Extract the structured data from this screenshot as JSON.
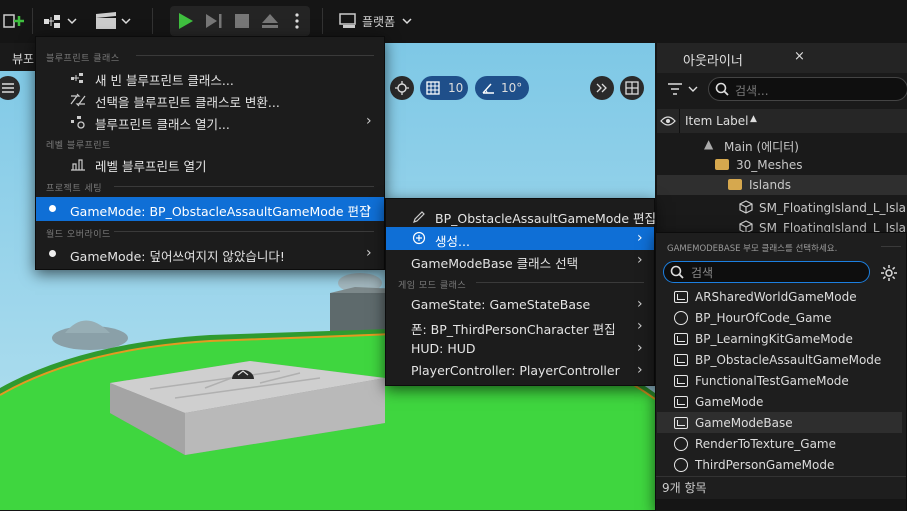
{
  "toolbar": {
    "platform_label": "플랫폼",
    "icons": [
      "add-content-icon",
      "blueprint-icon",
      "cinematics-icon",
      "play-icon",
      "step-icon",
      "stop-icon",
      "eject-icon",
      "more-icon",
      "platform-icon"
    ]
  },
  "viewport": {
    "tab_label": "뷰포",
    "grid_value": "10",
    "angle_value": "10°"
  },
  "outliner": {
    "title": "아웃라이너",
    "close": "×",
    "search_placeholder": "검색...",
    "column_label": "Item Label",
    "rows": [
      {
        "label": "Main (에디터)"
      },
      {
        "label": "30_Meshes"
      },
      {
        "label": "Islands"
      },
      {
        "label": "SM_FloatingIsland_L_Islar"
      },
      {
        "label": "SM_FloatingIsland_L_Islar"
      }
    ]
  },
  "main_menu": {
    "sections": [
      {
        "title": "블루프린트 클래스"
      },
      {
        "title": "레벨 블루프린트"
      },
      {
        "title": "프로젝트 세팅"
      },
      {
        "title": "월드 오버라이드"
      }
    ],
    "items": {
      "new_bp": "새 빈 블루프린트 클래스...",
      "convert": "선택을 블루프린트 클래스로 변환...",
      "open_bp": "블루프린트 클래스 열기...",
      "open_level_bp": "레벨 블루프린트 열기",
      "gamemode_edit": "GameMode: BP_ObstacleAssaultGameMode 편집",
      "gamemode_override": "GameMode: 덮어쓰여지지 않았습니다!"
    }
  },
  "sub_menu": {
    "edit_label": "BP_ObstacleAssaultGameMode 편집",
    "create_label": "생성...",
    "select_base": "GameModeBase 클래스 선택",
    "section_title": "게임 모드 클래스",
    "items": [
      {
        "label": "GameState: GameStateBase"
      },
      {
        "label": "폰: BP_ThirdPersonCharacter 편집"
      },
      {
        "label": "HUD: HUD"
      },
      {
        "label": "PlayerController: PlayerController"
      }
    ]
  },
  "class_picker": {
    "title": "GAMEMODEBASE 부모 클래스를 선택하세요.",
    "search_placeholder": "검색",
    "items": [
      {
        "label": "ARSharedWorldGameMode",
        "icon": "blueprint"
      },
      {
        "label": "BP_HourOfCode_Game",
        "icon": "circle"
      },
      {
        "label": "BP_LearningKitGameMode",
        "icon": "blueprint"
      },
      {
        "label": "BP_ObstacleAssaultGameMode",
        "icon": "blueprint"
      },
      {
        "label": "FunctionalTestGameMode",
        "icon": "blueprint"
      },
      {
        "label": "GameMode",
        "icon": "blueprint"
      },
      {
        "label": "GameModeBase",
        "icon": "blueprint"
      },
      {
        "label": "RenderToTexture_Game",
        "icon": "circle"
      },
      {
        "label": "ThirdPersonGameMode",
        "icon": "circle"
      }
    ],
    "count_label": "9개 항목"
  },
  "colors": {
    "highlight": "#0f6fd6",
    "play_green": "#3fbf3f",
    "grass": "#3fd63f",
    "sky": "#8ecfe7"
  }
}
